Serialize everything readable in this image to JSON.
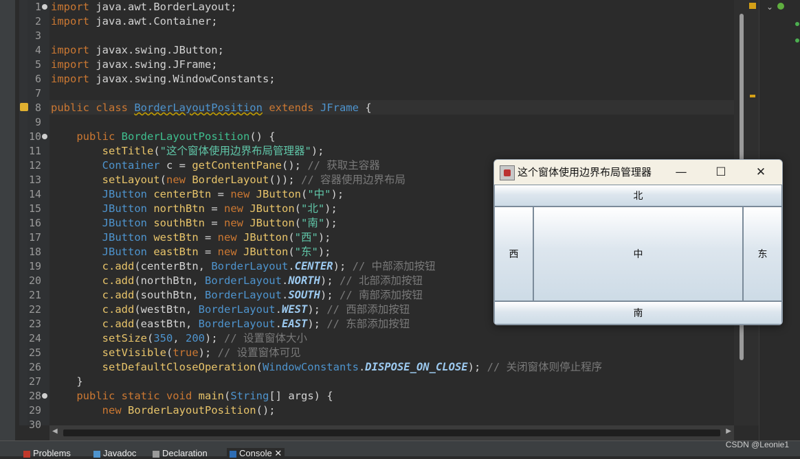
{
  "editor": {
    "lines": [
      {
        "n": "1",
        "html": "<span class='kw'>import</span> java.awt.BorderLayout;"
      },
      {
        "n": "2",
        "html": "<span class='kw'>import</span> java.awt.Container;"
      },
      {
        "n": "3",
        "html": ""
      },
      {
        "n": "4",
        "html": "<span class='kw'>import</span> javax.swing.JButton;"
      },
      {
        "n": "5",
        "html": "<span class='kw'>import</span> javax.swing.JFrame;"
      },
      {
        "n": "6",
        "html": "<span class='kw'>import</span> javax.swing.WindowConstants;"
      },
      {
        "n": "7",
        "html": ""
      },
      {
        "n": "8",
        "html": "<span class='kw'>public class</span> <span class='ty squig'>BorderLayoutPosition</span> <span class='kw'>extends</span> <span class='ty'>JFrame</span> {"
      },
      {
        "n": "9",
        "html": ""
      },
      {
        "n": "10",
        "html": "    <span class='kw'>public</span> <span class='meth'>BorderLayoutPosition</span>() {"
      },
      {
        "n": "11",
        "html": "        <span class='fn'>setTitle</span>(<span class='str'>\"这个窗体使用边界布局管理器\"</span>);"
      },
      {
        "n": "12",
        "html": "        <span class='ty'>Container</span> c = <span class='fn'>getContentPane</span>(); <span class='cm'>// 获取主容器</span>"
      },
      {
        "n": "13",
        "html": "        <span class='fn'>setLayout</span>(<span class='kw'>new</span> <span class='fn'>BorderLayout</span>()); <span class='cm'>// 容器使用边界布局</span>"
      },
      {
        "n": "14",
        "html": "        <span class='ty'>JButton</span> <span class='fn'>centerBtn</span> = <span class='kw'>new</span> <span class='fn'>JButton</span>(<span class='str'>\"中\"</span>);"
      },
      {
        "n": "15",
        "html": "        <span class='ty'>JButton</span> <span class='fn'>northBtn</span> = <span class='kw'>new</span> <span class='fn'>JButton</span>(<span class='str'>\"北\"</span>);"
      },
      {
        "n": "16",
        "html": "        <span class='ty'>JButton</span> <span class='fn'>southBtn</span> = <span class='kw'>new</span> <span class='fn'>JButton</span>(<span class='str'>\"南\"</span>);"
      },
      {
        "n": "17",
        "html": "        <span class='ty'>JButton</span> <span class='fn'>westBtn</span> = <span class='kw'>new</span> <span class='fn'>JButton</span>(<span class='str'>\"西\"</span>);"
      },
      {
        "n": "18",
        "html": "        <span class='ty'>JButton</span> <span class='fn'>eastBtn</span> = <span class='kw'>new</span> <span class='fn'>JButton</span>(<span class='str'>\"东\"</span>);"
      },
      {
        "n": "19",
        "html": "        <span class='fn'>c.add</span>(centerBtn, <span class='ty'>BorderLayout</span>.<span class='cst'>CENTER</span>); <span class='cm'>// 中部添加按钮</span>"
      },
      {
        "n": "20",
        "html": "        <span class='fn'>c.add</span>(northBtn, <span class='ty'>BorderLayout</span>.<span class='cst'>NORTH</span>); <span class='cm'>// 北部添加按钮</span>"
      },
      {
        "n": "21",
        "html": "        <span class='fn'>c.add</span>(southBtn, <span class='ty'>BorderLayout</span>.<span class='cst'>SOUTH</span>); <span class='cm'>// 南部添加按钮</span>"
      },
      {
        "n": "22",
        "html": "        <span class='fn'>c.add</span>(westBtn, <span class='ty'>BorderLayout</span>.<span class='cst'>WEST</span>); <span class='cm'>// 西部添加按钮</span>"
      },
      {
        "n": "23",
        "html": "        <span class='fn'>c.add</span>(eastBtn, <span class='ty'>BorderLayout</span>.<span class='cst'>EAST</span>); <span class='cm'>// 东部添加按钮</span>"
      },
      {
        "n": "24",
        "html": "        <span class='fn'>setSize</span>(<span class='ty'>350</span>, <span class='ty'>200</span>); <span class='cm'>// 设置窗体大小</span>"
      },
      {
        "n": "25",
        "html": "        <span class='fn'>setVisible</span>(<span class='kw'>true</span>); <span class='cm'>// 设置窗体可见</span>"
      },
      {
        "n": "26",
        "html": "        <span class='fn'>setDefaultCloseOperation</span>(<span class='ty'>WindowConstants</span>.<span class='cst'>DISPOSE_ON_CLOSE</span>); <span class='cm'>// 关闭窗体则停止程序</span>"
      },
      {
        "n": "27",
        "html": "    }"
      },
      {
        "n": "28",
        "html": "    <span class='kw'>public static void</span> <span class='fn'>main</span>(<span class='ty'>String</span>[] args) {"
      },
      {
        "n": "29",
        "html": "        <span class='kw'>new</span> <span class='fn'>BorderLayoutPosition</span>();"
      },
      {
        "n": "30",
        "html": ""
      }
    ]
  },
  "bottom_tabs": [
    {
      "label": "Problems"
    },
    {
      "label": "Javadoc"
    },
    {
      "label": "Declaration"
    },
    {
      "label": "Console"
    }
  ],
  "watermark": "CSDN @Leonie1",
  "swing_window": {
    "title": "这个窗体使用边界布局管理器",
    "minimize": "—",
    "maximize": "☐",
    "close": "✕",
    "north": "北",
    "west": "西",
    "center": "中",
    "east": "东",
    "south": "南"
  }
}
